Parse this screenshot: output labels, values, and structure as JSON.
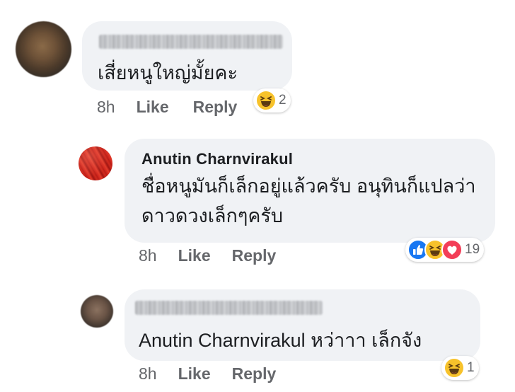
{
  "comments": [
    {
      "name": "",
      "text": "เสี่ยหนูใหญ่มั้ยคะ",
      "time": "8h",
      "like": "Like",
      "reply": "Reply",
      "reactions": {
        "icons": [
          "haha-icon"
        ],
        "count": "2"
      }
    },
    {
      "name": "Anutin Charnvirakul",
      "text": "ชื่อหนูมันก็เล็กอยู่แล้วครับ อนุทินก็แปลว่าดาวดวงเล็กๆครับ",
      "time": "8h",
      "like": "Like",
      "reply": "Reply",
      "reactions": {
        "icons": [
          "like-icon",
          "haha-icon",
          "love-icon"
        ],
        "count": "19"
      }
    },
    {
      "name": "",
      "text": "Anutin Charnvirakul  หว่าาา เล็กจัง",
      "time": "8h",
      "like": "Like",
      "reply": "Reply",
      "reactions": {
        "icons": [
          "haha-icon"
        ],
        "count": "1"
      }
    }
  ],
  "colors": {
    "bubble": "#f0f2f5",
    "meta": "#65676b",
    "like": "#1877f2",
    "haha": "#f7c22b",
    "love": "#f33e58"
  }
}
